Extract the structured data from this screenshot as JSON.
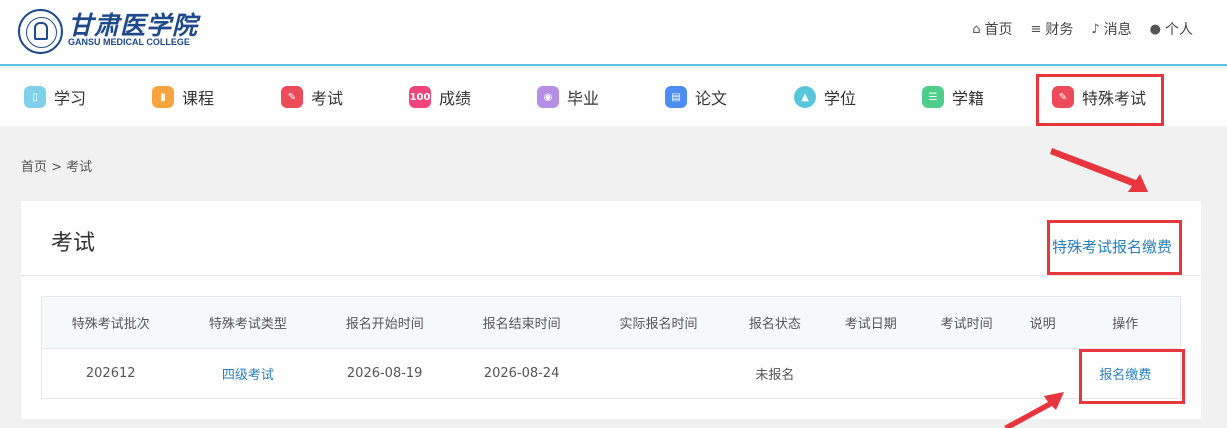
{
  "header": {
    "college_cn": "甘肃医学院",
    "college_en": "GANSU MEDICAL COLLEGE",
    "topnav": [
      {
        "label": "首页",
        "icon": "home-icon"
      },
      {
        "label": "财务",
        "icon": "database-icon"
      },
      {
        "label": "消息",
        "icon": "bell-icon"
      },
      {
        "label": "个人",
        "icon": "user-icon"
      }
    ]
  },
  "mainnav": [
    {
      "label": "学习",
      "icon": "study-icon",
      "color": "#7fd1e8"
    },
    {
      "label": "课程",
      "icon": "course-icon",
      "color": "#f7a440"
    },
    {
      "label": "考试",
      "icon": "exam-icon",
      "color": "#ee4b5a"
    },
    {
      "label": "成绩",
      "icon": "grade-icon",
      "color": "#f0457a",
      "icon_text": "100"
    },
    {
      "label": "毕业",
      "icon": "graduation-icon",
      "color": "#b58ee6"
    },
    {
      "label": "论文",
      "icon": "thesis-icon",
      "color": "#4c8ef2"
    },
    {
      "label": "学位",
      "icon": "degree-icon",
      "color": "#57c6dc"
    },
    {
      "label": "学籍",
      "icon": "status-icon",
      "color": "#4fcd8b"
    },
    {
      "label": "特殊考试",
      "icon": "special-exam-icon",
      "color": "#ee4b5a"
    }
  ],
  "breadcrumb": "首页 > 考试",
  "panel": {
    "title": "考试",
    "special_link": "特殊考试报名缴费",
    "table": {
      "headers": [
        "特殊考试批次",
        "特殊考试类型",
        "报名开始时间",
        "报名结束时间",
        "实际报名时间",
        "报名状态",
        "考试日期",
        "考试时间",
        "说明",
        "操作"
      ],
      "rows": [
        {
          "batch": "202612",
          "type": "四级考试",
          "start": "2026-08-19",
          "end": "2026-08-24",
          "actual": "",
          "status": "未报名",
          "exam_date": "",
          "exam_time": "",
          "note": "",
          "action": "报名缴费"
        }
      ]
    }
  },
  "colors": {
    "accent": "#2a7fb8",
    "highlight": "#e8363e",
    "header_border": "#5bc2e2"
  }
}
